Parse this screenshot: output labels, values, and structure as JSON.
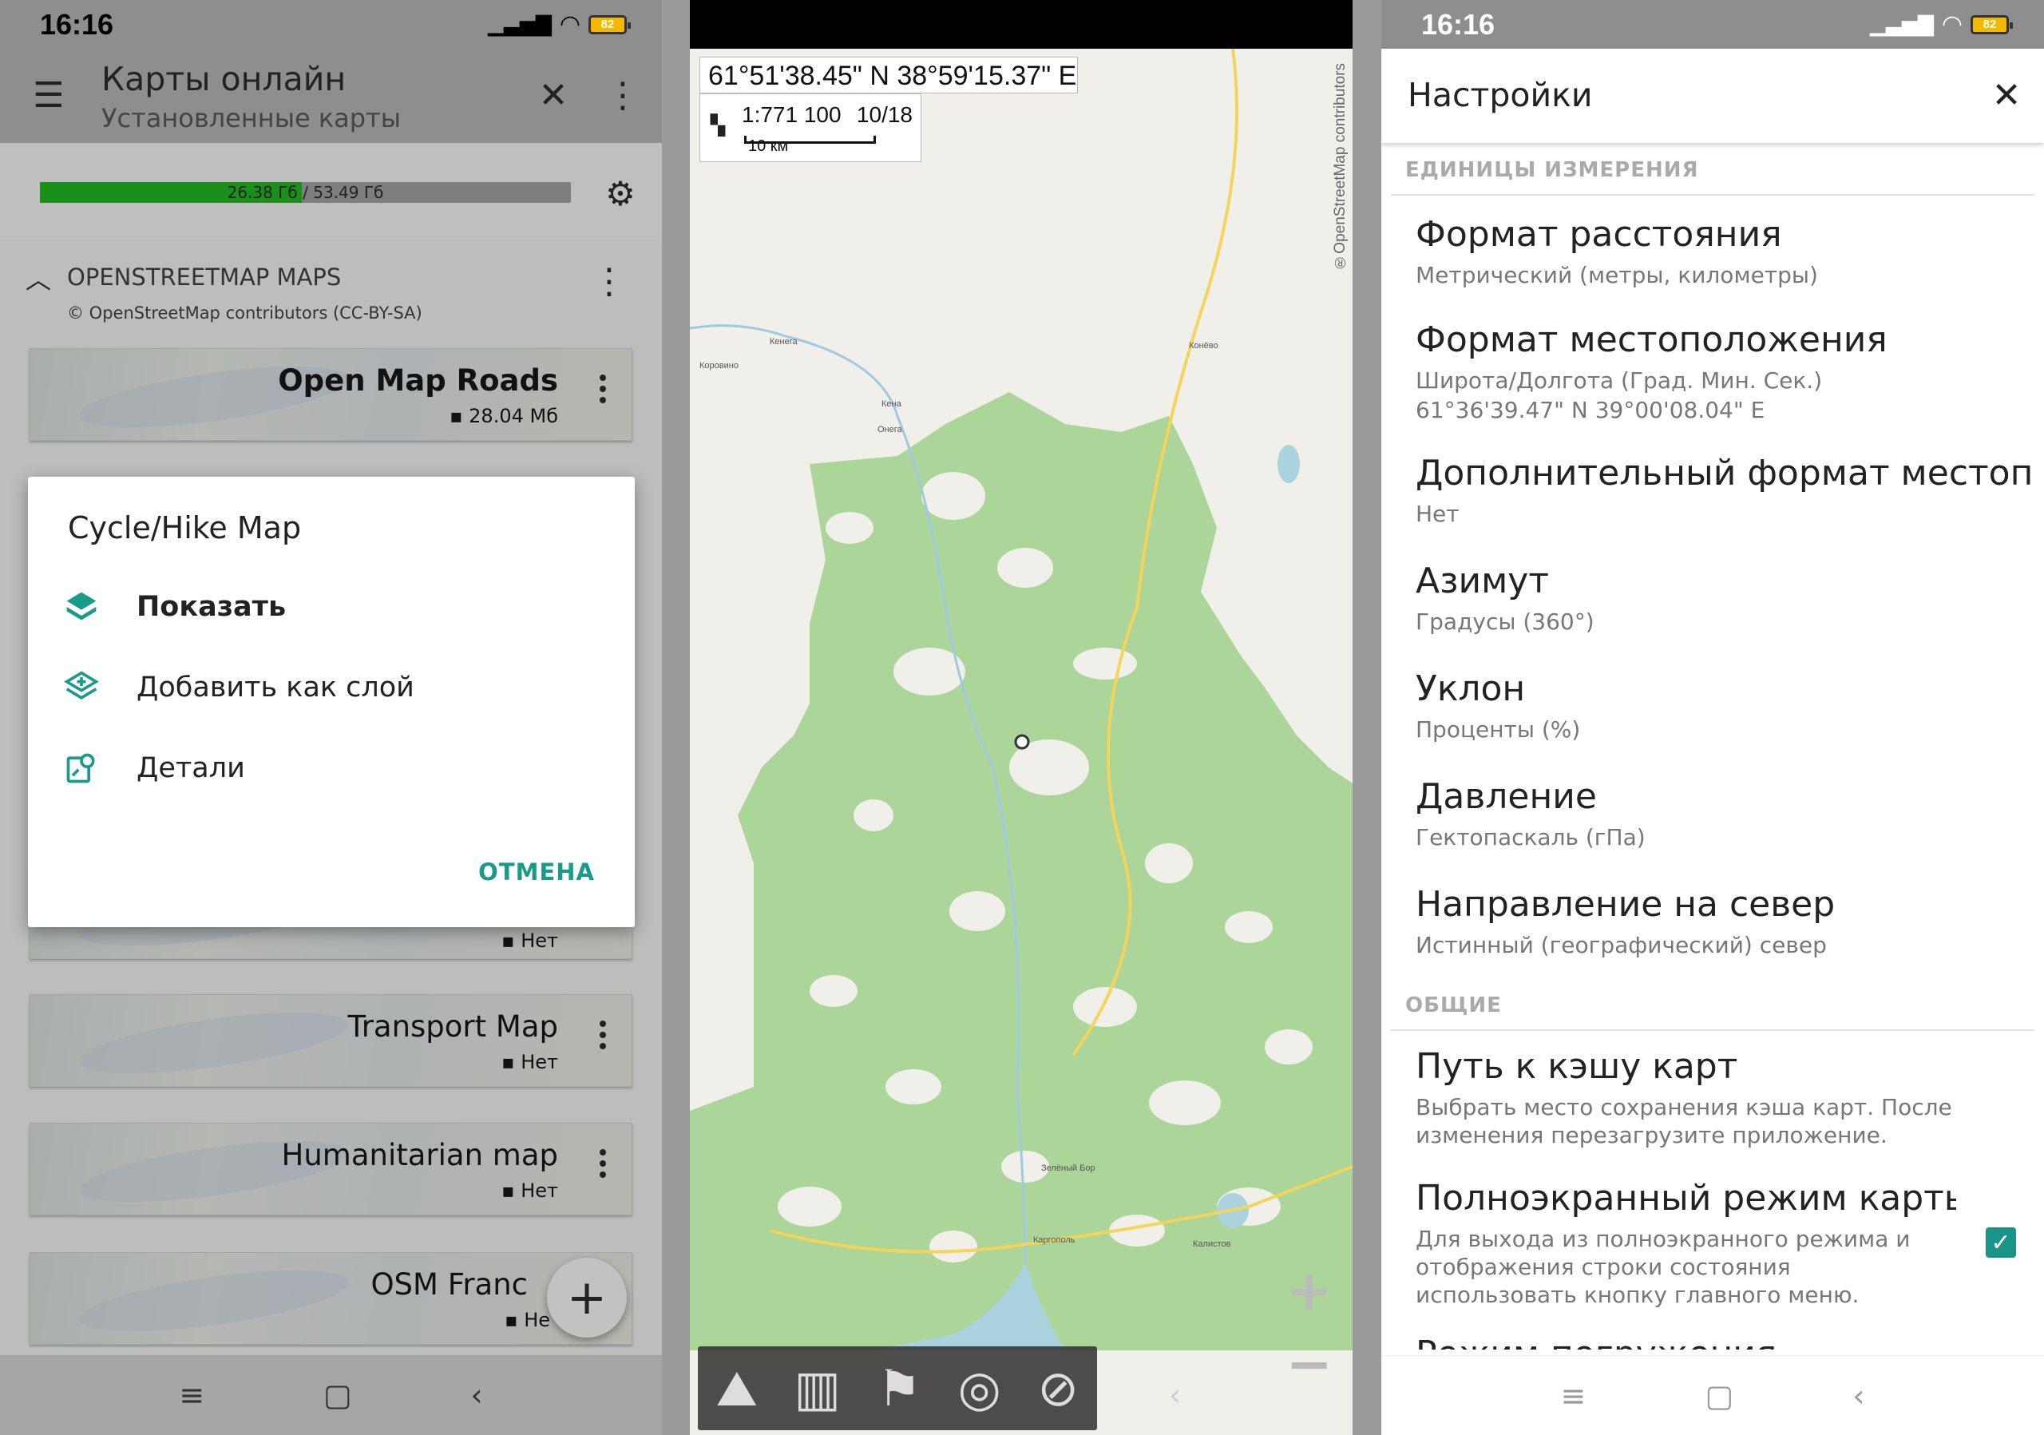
{
  "status_left": {
    "time": "16:16",
    "battery": "82"
  },
  "status_right": {
    "time": "16:16",
    "battery": "82"
  },
  "maps_screen": {
    "title": "Карты онлайн",
    "subtitle": "Установленные карты",
    "storage": {
      "text": "26.38 Гб / 53.49 Гб",
      "used": 26.38,
      "total": 53.49
    },
    "section": {
      "title": "OPENSTREETMAP MAPS",
      "license": "© OpenStreetMap contributors (CC-BY-SA)"
    },
    "cards": [
      {
        "name": "Open Map Roads",
        "size": "28.04 Мб"
      },
      {
        "name": "",
        "size": "Нет"
      },
      {
        "name": "Transport Map",
        "size": "Нет"
      },
      {
        "name": "Humanitarian map",
        "size": "Нет"
      },
      {
        "name": "OSM Franc",
        "size": "Не"
      }
    ],
    "dialog": {
      "title": "Cycle/Hike Map",
      "items": [
        {
          "label": "Показать",
          "icon": "layers-icon"
        },
        {
          "label": "Добавить как слой",
          "icon": "add-layer-icon"
        },
        {
          "label": "Детали",
          "icon": "details-icon"
        }
      ],
      "cancel": "ОТМЕНА"
    }
  },
  "map_screen": {
    "coords": "61°51'38.45\" N 38°59'15.37\" E",
    "scale": "1:771 100",
    "zoom": "10/18",
    "scale_bar": "10 км",
    "attribution": "®OpenStreetMap contributors",
    "places": [
      "Коровино",
      "Кенега",
      "Конёво",
      "Кена",
      "Онега",
      "Зелёный Бор",
      "Каргополь",
      "Калистов"
    ]
  },
  "settings_screen": {
    "title": "Настройки",
    "section1": "ЕДИНИЦЫ ИЗМЕРЕНИЯ",
    "section2": "ОБЩИЕ",
    "options": [
      {
        "title": "Формат расстояния",
        "summary": "Метрический (метры, километры)"
      },
      {
        "title": "Формат местоположения",
        "summary": "Широта/Долгота (Град. Мин. Сек.)",
        "summary2": "61°36'39.47\" N 39°00'08.04\" E"
      },
      {
        "title": "Дополнительный формат местоположения",
        "summary": "Нет"
      },
      {
        "title": "Азимут",
        "summary": "Градусы (360°)"
      },
      {
        "title": "Уклон",
        "summary": "Проценты (%)"
      },
      {
        "title": "Давление",
        "summary": "Гектопаскаль (гПа)"
      },
      {
        "title": "Направление на север",
        "summary": "Истинный (географический) север"
      },
      {
        "title": "Путь к кэшу карт",
        "summary": "Выбрать место сохранения кэша карт. После изменения перезагрузите приложение."
      },
      {
        "title": "Полноэкранный режим карты",
        "summary": "Для выхода из полноэкранного режима и отображения строки состояния использовать кнопку главного меню.",
        "checked": true
      },
      {
        "title": "Режим погружения",
        "summary": ""
      }
    ]
  },
  "colors": {
    "accent": "#1a9488",
    "progress": "#1a8f1a",
    "forest": "#acd59a"
  }
}
